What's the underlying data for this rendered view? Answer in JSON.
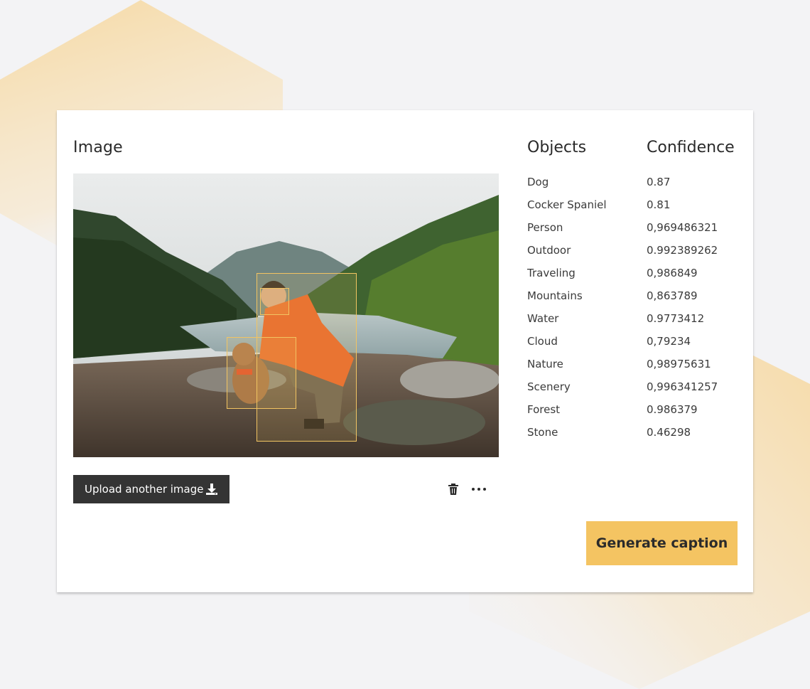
{
  "colors": {
    "accent": "#f4c462",
    "dark_button": "#343434",
    "background": "#f3f3f5",
    "bbox": "#f2c462"
  },
  "image_panel": {
    "title": "Image",
    "photo_alt": "mountain-lake-person-dog-photo",
    "upload_label": "Upload another image",
    "upload_icon": "download-icon",
    "delete_icon": "trash-icon",
    "more_icon": "more-horizontal-icon"
  },
  "results": {
    "objects_header": "Objects",
    "confidence_header": "Confidence",
    "rows": [
      {
        "object": "Dog",
        "confidence": "0.87"
      },
      {
        "object": "Cocker Spaniel",
        "confidence": "0.81"
      },
      {
        "object": "Person",
        "confidence": "0,969486321"
      },
      {
        "object": "Outdoor",
        "confidence": "0.992389262"
      },
      {
        "object": "Traveling",
        "confidence": "0,986849"
      },
      {
        "object": "Mountains",
        "confidence": "0,863789"
      },
      {
        "object": "Water",
        "confidence": "0.9773412"
      },
      {
        "object": "Cloud",
        "confidence": "0,79234"
      },
      {
        "object": "Nature",
        "confidence": "0,98975631"
      },
      {
        "object": "Scenery",
        "confidence": "0,996341257"
      },
      {
        "object": "Forest",
        "confidence": "0.986379"
      },
      {
        "object": "Stone",
        "confidence": "0.46298"
      }
    ]
  },
  "actions": {
    "generate_label": "Generate caption"
  }
}
